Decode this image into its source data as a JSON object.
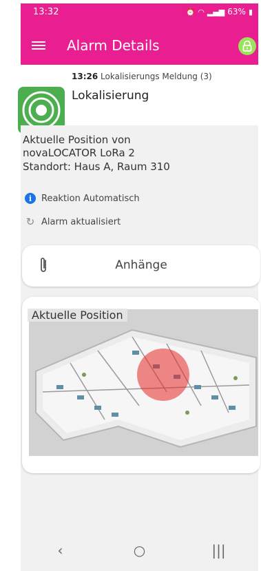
{
  "status_bar": {
    "time": "13:32",
    "battery": "63%"
  },
  "app_bar": {
    "title": "Alarm Details",
    "menu_icon": "menu-icon",
    "lock_icon": "lock-icon"
  },
  "alarm": {
    "time": "13:26",
    "message": "Lokalisierungs Meldung (3)",
    "title": "Lokalisierung",
    "color": "#4cae4f"
  },
  "info": {
    "line1": "Aktuelle Position von",
    "line2": "novaLOCATOR LoRa 2",
    "line3": "Standort: Haus A, Raum 310",
    "reaction": "Reaktion Automatisch",
    "updated": "Alarm aktualisiert"
  },
  "attachments": {
    "label": "Anhänge"
  },
  "map": {
    "title": "Aktuelle Position"
  },
  "nav": {
    "back": "‹",
    "home": "○",
    "recents": "|||"
  },
  "colors": {
    "accent": "#e81e91",
    "lock": "#9be35a",
    "info": "#1a73e8"
  }
}
